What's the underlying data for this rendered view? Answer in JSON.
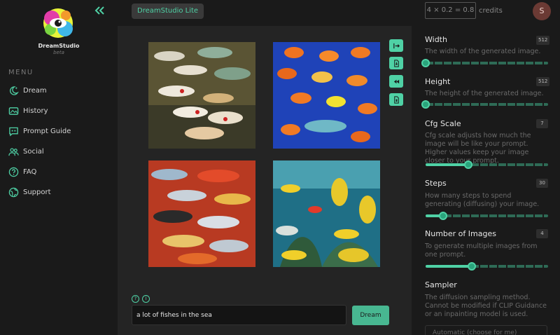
{
  "header": {
    "app_pill": "DreamStudio Lite",
    "credits_formula": "4 × 0.2 = 0.8",
    "credits_label": "credits",
    "avatar_letter": "S"
  },
  "sidebar": {
    "brand": "DreamStudio",
    "brand_sub": "beta",
    "menu_heading": "MENU",
    "items": [
      {
        "label": "Dream",
        "icon": "moon-sparkle-icon"
      },
      {
        "label": "History",
        "icon": "image-gallery-icon"
      },
      {
        "label": "Prompt Guide",
        "icon": "quote-bubble-icon"
      },
      {
        "label": "Social",
        "icon": "people-icon"
      },
      {
        "label": "FAQ",
        "icon": "question-circle-icon"
      },
      {
        "label": "Support",
        "icon": "globe-icon"
      }
    ]
  },
  "prompt": {
    "value": "a lot of fishes in the sea",
    "submit_label": "Dream"
  },
  "settings": {
    "width": {
      "title": "Width",
      "value": "512",
      "desc": "The width of the generated image.",
      "fraction": 0.0
    },
    "height": {
      "title": "Height",
      "value": "512",
      "desc": "The height of the generated image.",
      "fraction": 0.0
    },
    "cfg": {
      "title": "Cfg Scale",
      "value": "7",
      "desc": "Cfg scale adjusts how much the image will be like your prompt. Higher values keep your image closer to your prompt.",
      "fraction": 0.35
    },
    "steps": {
      "title": "Steps",
      "value": "30",
      "desc": "How many steps to spend generating (diffusing) your image.",
      "fraction": 0.14
    },
    "images": {
      "title": "Number of Images",
      "value": "4",
      "desc": "To generate multiple images from one prompt.",
      "fraction": 0.375
    },
    "sampler": {
      "title": "Sampler",
      "desc": "The diffusion sampling method. Cannot be modified if CLIP Guidance or an inpainting model is used.",
      "selected": "Automatic (choose for me)"
    }
  },
  "colors": {
    "accent": "#4fd1a5",
    "panel": "#1a1a1a",
    "canvas": "#242424"
  }
}
